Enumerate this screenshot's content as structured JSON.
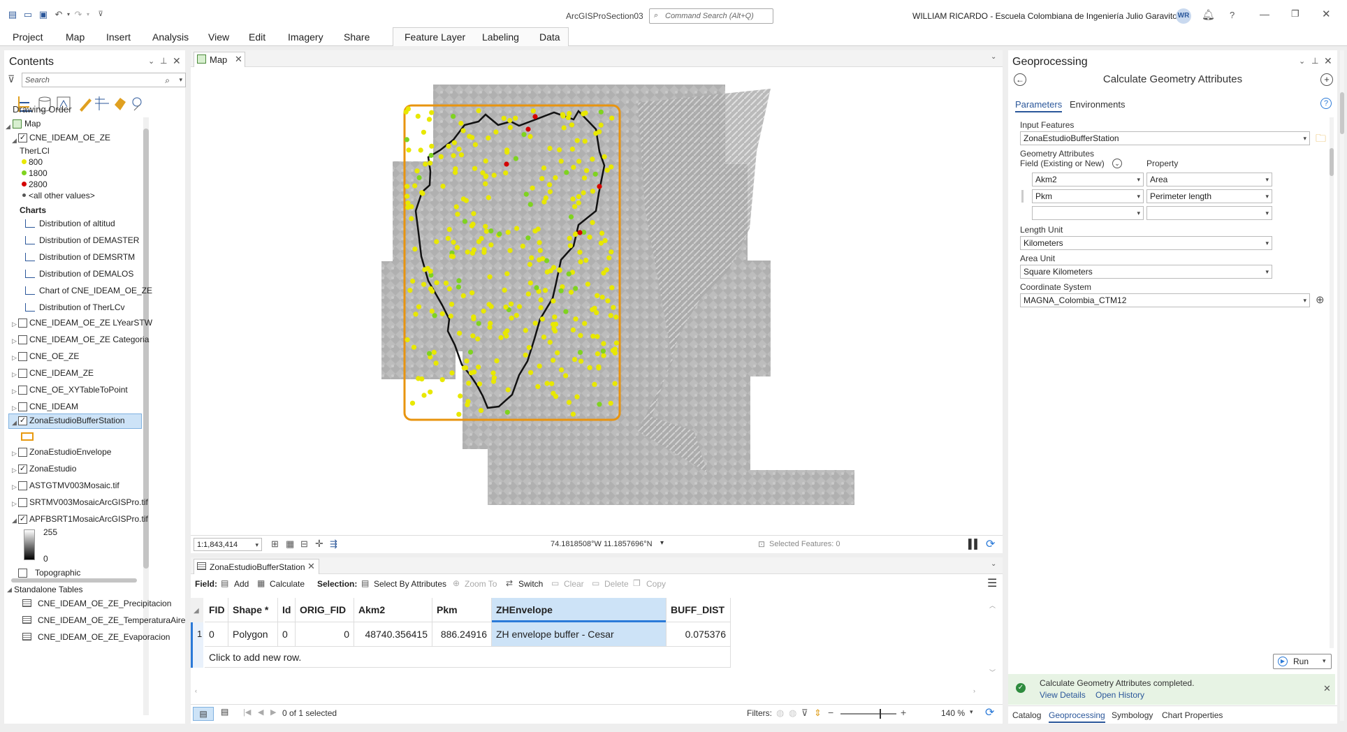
{
  "app": {
    "title": "ArcGISProSection03",
    "search_placeholder": "Command Search (Alt+Q)",
    "user": "WILLIAM RICARDO  - Escuela Colombiana de Ingeniería Julio Garavito",
    "initials": "WR"
  },
  "ribbon": {
    "tabs": [
      "Project",
      "Map",
      "Insert",
      "Analysis",
      "View",
      "Edit",
      "Imagery",
      "Share"
    ],
    "context_tabs": [
      "Feature Layer",
      "Labeling",
      "Data"
    ]
  },
  "contents": {
    "title": "Contents",
    "search_placeholder": "Search",
    "drawing_order": "Drawing Order",
    "map_label": "Map",
    "layer1": "CNE_IDEAM_OE_ZE",
    "legend_field": "TherLCl",
    "legend": [
      {
        "label": "800",
        "color": "#e8e800"
      },
      {
        "label": "1800",
        "color": "#7fd320"
      },
      {
        "label": "2800",
        "color": "#d40000"
      }
    ],
    "other_values": "<all other values>",
    "charts_title": "Charts",
    "charts": [
      "Distribution of altitud",
      "Distribution of DEMASTER",
      "Distribution of DEMSRTM",
      "Distribution of DEMALOS",
      "Chart of CNE_IDEAM_OE_ZE",
      "Distribution of TherLCv"
    ],
    "layers_a": [
      "CNE_IDEAM_OE_ZE LYearSTW",
      "CNE_IDEAM_OE_ZE Categoria",
      "CNE_OE_ZE",
      "CNE_IDEAM_ZE",
      "CNE_OE_XYTableToPoint",
      "CNE_IDEAM"
    ],
    "selected_layer": "ZonaEstudioBufferStation",
    "layers_b": [
      "ZonaEstudioEnvelope",
      "ZonaEstudio",
      "ASTGTMV003Mosaic.tif",
      "SRTMV003MosaicArcGISPro.tif",
      "APFBSRT1MosaicArcGISPro.tif"
    ],
    "raster_high": "255",
    "raster_low": "0",
    "topographic": "Topographic",
    "standalone_title": "Standalone Tables",
    "tables": [
      "CNE_IDEAM_OE_ZE_Precipitacion",
      "CNE_IDEAM_OE_ZE_TemperaturaAire",
      "CNE_IDEAM_OE_ZE_Evaporacion"
    ]
  },
  "map": {
    "tab": "Map",
    "scale": "1:1,843,414",
    "coords": "74.1818508°W 11.1857696°N",
    "selected": "Selected Features: 0"
  },
  "table": {
    "tab": "ZonaEstudioBufferStation",
    "field_label": "Field:",
    "add": "Add",
    "calculate": "Calculate",
    "selection_label": "Selection:",
    "select_by_attr": "Select By Attributes",
    "zoom_to": "Zoom To",
    "switch": "Switch",
    "clear": "Clear",
    "delete": "Delete",
    "copy": "Copy",
    "headers": [
      "FID",
      "Shape *",
      "Id",
      "ORIG_FID",
      "Akm2",
      "Pkm",
      "ZHEnvelope",
      "BUFF_DIST"
    ],
    "row_num": "1",
    "row": [
      "0",
      "Polygon",
      "0",
      "0",
      "48740.356415",
      "886.24916",
      "ZH envelope buffer - Cesar",
      "0.075376"
    ],
    "add_row": "Click to add new row.",
    "selection_count": "0 of 1 selected",
    "filters": "Filters:",
    "zoom": "140 %"
  },
  "gp": {
    "title": "Geoprocessing",
    "tool": "Calculate Geometry Attributes",
    "tab_params": "Parameters",
    "tab_env": "Environments",
    "input_label": "Input Features",
    "input_value": "ZonaEstudioBufferStation",
    "geom_attrs": "Geometry Attributes",
    "field_col": "Field (Existing or New)",
    "prop_col": "Property",
    "rows": [
      {
        "field": "Akm2",
        "prop": "Area"
      },
      {
        "field": "Pkm",
        "prop": "Perimeter length"
      },
      {
        "field": "",
        "prop": ""
      }
    ],
    "length_label": "Length Unit",
    "length_value": "Kilometers",
    "area_label": "Area Unit",
    "area_value": "Square Kilometers",
    "cs_label": "Coordinate System",
    "cs_value": "MAGNA_Colombia_CTM12",
    "run": "Run",
    "msg": "Calculate Geometry Attributes completed.",
    "view_details": "View Details",
    "open_history": "Open History",
    "bottom_tabs": [
      "Catalog",
      "Geoprocessing",
      "Symbology",
      "Chart Properties"
    ]
  }
}
